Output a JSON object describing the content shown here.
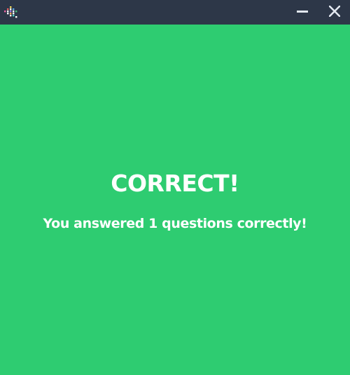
{
  "window": {
    "background_color": "#2ecc71",
    "titlebar_color": "#2d3748",
    "logo_icon": "app-logo-icon",
    "minimize_icon": "minimize-icon",
    "close_icon": "close-icon"
  },
  "result": {
    "heading": "CORRECT!",
    "message": "You answered 1 questions correctly!"
  }
}
